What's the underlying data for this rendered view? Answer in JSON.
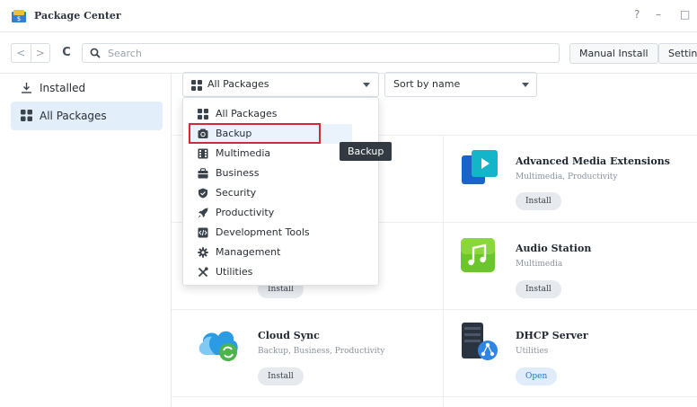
{
  "window": {
    "title": "Package Center",
    "controls": [
      "?",
      "–",
      "□"
    ]
  },
  "toolbar": {
    "back": "<",
    "forward": ">",
    "refresh": "C",
    "search_placeholder": "Search",
    "manual_install": "Manual Install",
    "settings": "Setting"
  },
  "sidebar": {
    "items": [
      {
        "label": "Installed"
      },
      {
        "label": "All Packages"
      }
    ]
  },
  "filter": {
    "category_value": "All Packages",
    "sort_value": "Sort by name"
  },
  "dropdown": {
    "items": [
      {
        "label": "All Packages"
      },
      {
        "label": "Backup"
      },
      {
        "label": "Multimedia"
      },
      {
        "label": "Business"
      },
      {
        "label": "Security"
      },
      {
        "label": "Productivity"
      },
      {
        "label": "Development Tools"
      },
      {
        "label": "Management"
      },
      {
        "label": "Utilities"
      }
    ]
  },
  "tooltip": "Backup",
  "packages": [
    {
      "name": "Advanced Media Extensions",
      "categories": "Multimedia, Productivity",
      "action": "Install"
    },
    {
      "name": "Audio Station",
      "categories": "Multimedia",
      "action": "Install"
    },
    {
      "name": "Cloud Sync",
      "categories": "Backup, Business, Productivity",
      "action": "Install"
    },
    {
      "name": "DHCP Server",
      "categories": "Utilities",
      "action": "Open"
    }
  ],
  "hidden_left_action": "Install",
  "colors": {
    "accent": "#1d73d1",
    "highlight": "#d42a35",
    "active_bg": "#e3eefb"
  }
}
